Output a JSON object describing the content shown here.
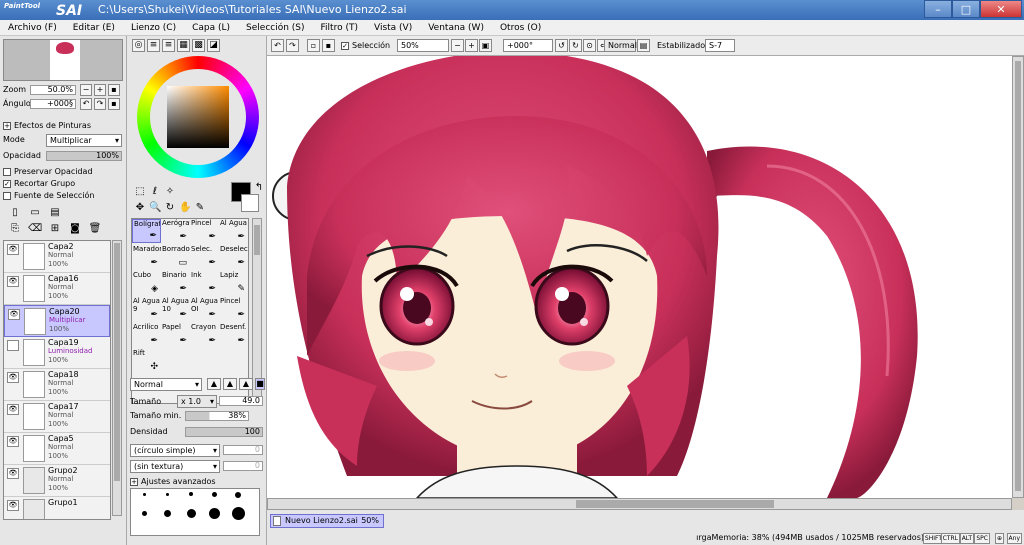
{
  "window": {
    "logo_small": "PaintTool",
    "logo_big": "SAI",
    "title": "C:\\Users\\Shukei\\Videos\\Tutoriales SAI\\Nuevo Lienzo2.sai",
    "minimize": "–",
    "maximize": "□",
    "close": "✕"
  },
  "menu": [
    "Archivo (F)",
    "Editar (E)",
    "Lienzo (C)",
    "Capa (L)",
    "Selección (S)",
    "Filtro (T)",
    "Vista (V)",
    "Ventana (W)",
    "Otros (O)"
  ],
  "navigator": {
    "zoom_label": "Zoom",
    "zoom_value": "50.0%",
    "angle_label": "Ángulo",
    "angle_value": "+000§"
  },
  "layer_props": {
    "effects_label": "Efectos de Pinturas",
    "mode_label": "Mode",
    "mode_value": "Multiplicar",
    "opacity_label": "Opacidad",
    "opacity_value": "100%",
    "preserve_opacity": "Preservar Opacidad",
    "clip_group": "Recortar Grupo",
    "selection_source": "Fuente de Selección"
  },
  "layers": [
    {
      "name": "Capa2",
      "mode": "Normal",
      "opacity": "100%",
      "mode_color": "gray"
    },
    {
      "name": "Capa16",
      "mode": "Normal",
      "opacity": "100%",
      "mode_color": "gray"
    },
    {
      "name": "Capa20",
      "mode": "Multiplicar",
      "opacity": "100%",
      "mode_color": "purple"
    },
    {
      "name": "Capa19",
      "mode": "Luminosidad",
      "opacity": "100%",
      "mode_color": "purple"
    },
    {
      "name": "Capa18",
      "mode": "Normal",
      "opacity": "100%",
      "mode_color": "gray"
    },
    {
      "name": "Capa17",
      "mode": "Normal",
      "opacity": "100%",
      "mode_color": "gray"
    },
    {
      "name": "Capa5",
      "mode": "Normal",
      "opacity": "100%",
      "mode_color": "gray"
    },
    {
      "name": "Grupo2",
      "mode": "Normal",
      "opacity": "100%",
      "mode_color": "gray"
    },
    {
      "name": "Grupo1",
      "mode": "",
      "opacity": "",
      "mode_color": "gray"
    }
  ],
  "brushes": [
    "Bolígrafo",
    "Aerógraf",
    "Pincel",
    "Al Agua",
    "Marador",
    "Borrador",
    "Selec.",
    "Deselec.",
    "Cubo",
    "Binario",
    "Ink",
    "Lapiz",
    "Al Agua 9",
    "Al Agua 10",
    "Al Agua OI",
    "Pincel",
    "Acrilico",
    "Papel",
    "Crayon",
    "Desenf.",
    "Rift"
  ],
  "brush_settings": {
    "mode": "Normal",
    "size_label": "Tamaño",
    "size_mult": "x 1.0",
    "size_value": "49.0",
    "min_size_label": "Tamaño min.",
    "min_size_value": "38%",
    "density_label": "Densidad",
    "density_value": "100",
    "shape": "(círculo simple)",
    "texture": "(sin textura)",
    "shape_value": "0",
    "texture_value": "0",
    "advanced": "Ajustes avanzados"
  },
  "toolbar": {
    "selection_label": "Selección",
    "zoom_value": "50%",
    "angle_value": "+000°",
    "mode_value": "Normal",
    "stabilizer_label": "Estabilizador",
    "stabilizer_value": "S-7"
  },
  "document": {
    "tab_name": "Nuevo Lienzo2.sai",
    "tab_zoom": "50%"
  },
  "status": {
    "memory": "ırgaMemoria: 38% (494MB usados / 1025MB reservados)",
    "keys": [
      "SHIFT",
      "CTRL",
      "ALT",
      "SPC",
      "⊕",
      "Any"
    ]
  },
  "colors": {
    "title_bar": "#3a6fb8",
    "selected_layer": "#c8c8ff",
    "hair": "#c8305a",
    "skin": "#fbeed8"
  }
}
